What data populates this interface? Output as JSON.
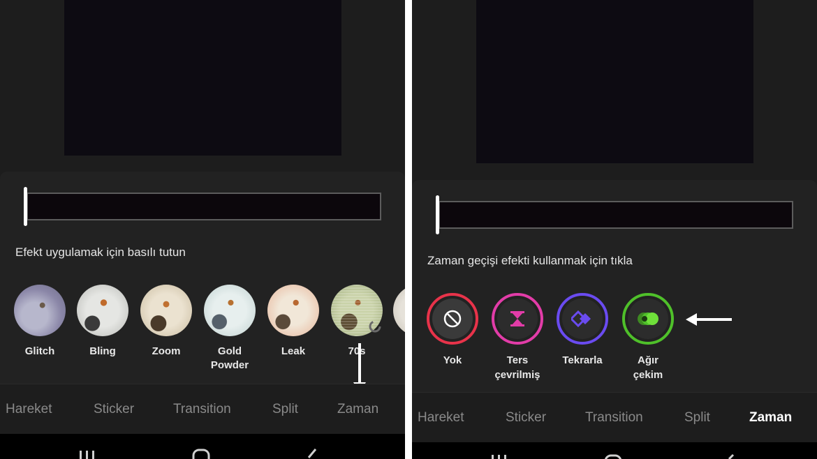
{
  "left": {
    "hint": "Efekt uygulamak için basılı tutun",
    "effects": [
      {
        "label": "Glitch"
      },
      {
        "label": "Bling"
      },
      {
        "label": "Zoom"
      },
      {
        "label": "Gold Powder"
      },
      {
        "label": "Leak"
      },
      {
        "label": "70s"
      }
    ],
    "tabs": [
      "Hareket",
      "Sticker",
      "Transition",
      "Split",
      "Zaman"
    ],
    "annotation": "down-arrow pointing to Zaman tab"
  },
  "right": {
    "hint": "Zaman geçişi efekti kullanmak için tıkla",
    "time_effects": [
      {
        "label_line1": "Yok",
        "label_line2": "",
        "color": "#e8334a",
        "icon": "no-entry-icon"
      },
      {
        "label_line1": "Ters",
        "label_line2": "çevrilmiş",
        "color": "#e23ca8",
        "icon": "hourglass-icon"
      },
      {
        "label_line1": "Tekrarla",
        "label_line2": "",
        "color": "#6a4bf0",
        "icon": "repeat-diamond-icon"
      },
      {
        "label_line1": "Ağır",
        "label_line2": "çekim",
        "color": "#4fc02a",
        "icon": "slow-motion-icon"
      }
    ],
    "tabs": [
      "Hareket",
      "Sticker",
      "Transition",
      "Split",
      "Zaman"
    ],
    "active_tab": "Zaman",
    "annotation": "left-arrow pointing to Ağır çekim"
  },
  "system_nav": {
    "recent": "recent-apps-icon",
    "home": "home-icon",
    "back": "back-icon"
  }
}
